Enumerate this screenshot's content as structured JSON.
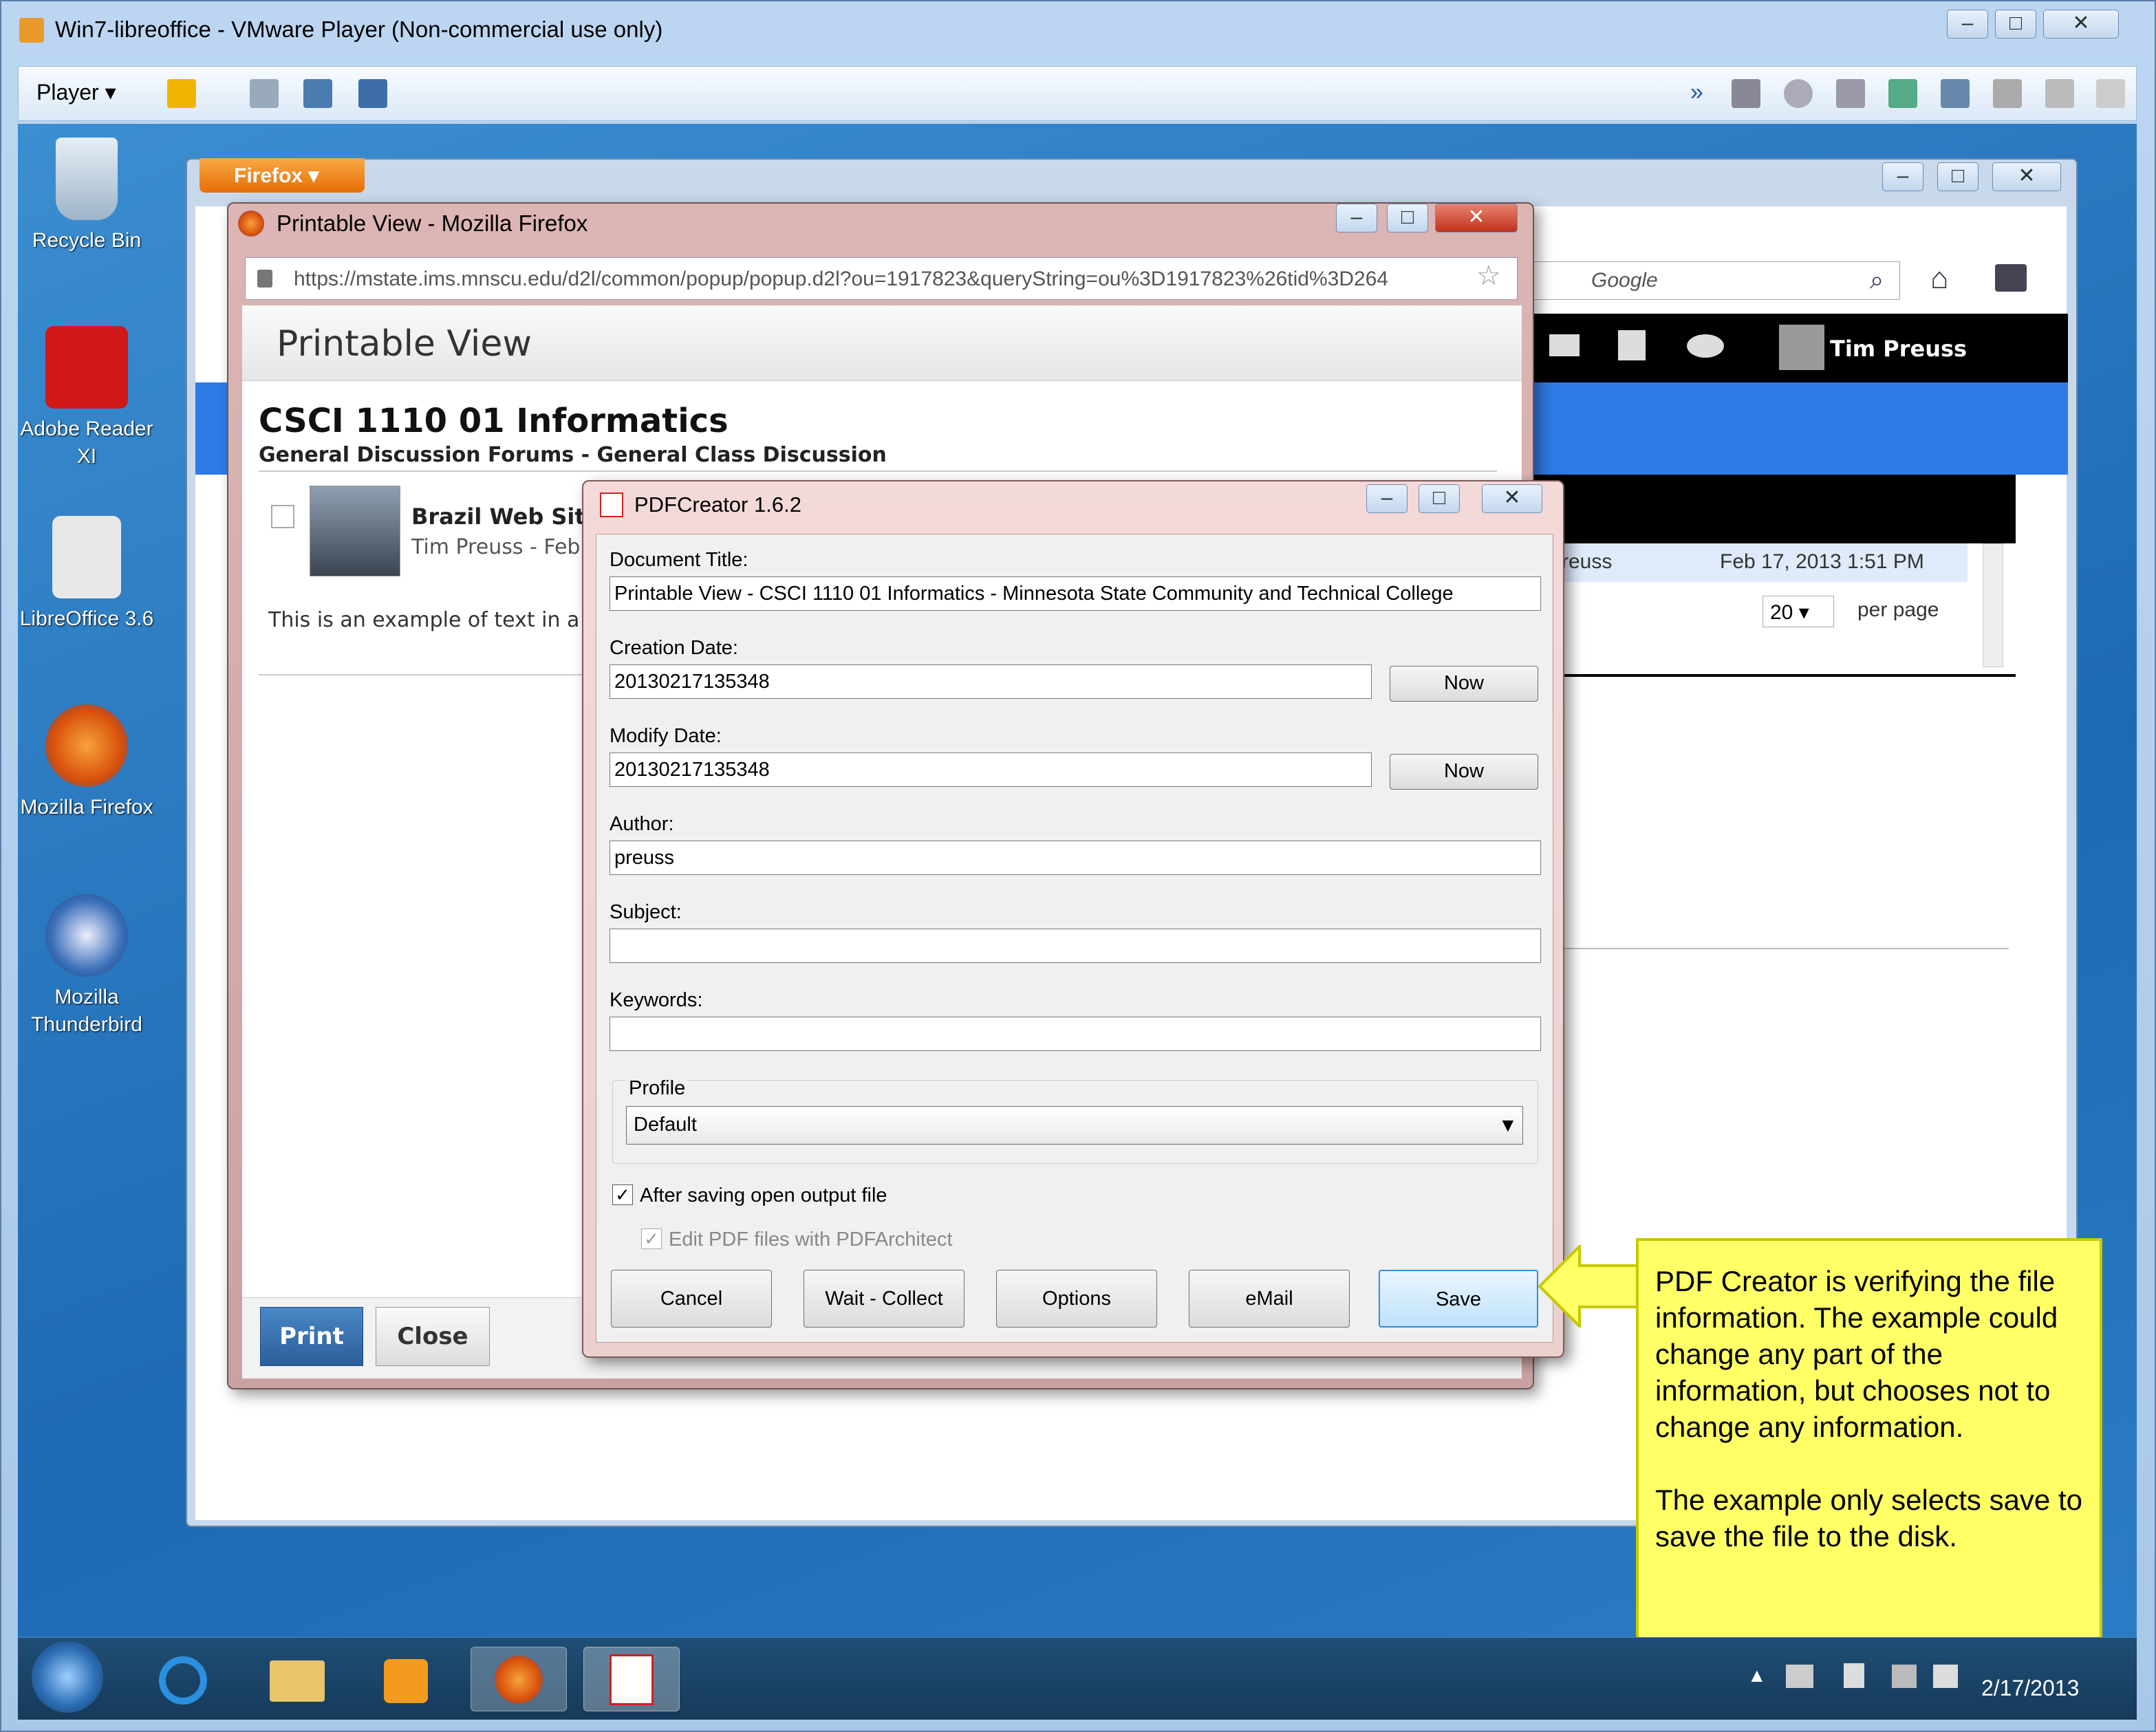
{
  "vmware": {
    "title": "Win7-libreoffice - VMware Player (Non-commercial use only)",
    "player_menu": "Player"
  },
  "desktop_icons": [
    {
      "label": "Recycle Bin"
    },
    {
      "label": "Adobe Reader XI"
    },
    {
      "label": "LibreOffice 3.6"
    },
    {
      "label": "Mozilla Firefox"
    },
    {
      "label": "Mozilla Thunderbird"
    }
  ],
  "firefox": {
    "app_button": "Firefox",
    "search_placeholder": "Google",
    "user_name": "Tim Preuss",
    "list_row_author": "reuss",
    "list_row_date": "Feb 17, 2013 1:51 PM",
    "per_page_value": "20",
    "per_page_label": "per page"
  },
  "printable_view": {
    "window_title": "Printable View - Mozilla Firefox",
    "url": "https://mstate.ims.mnscu.edu/d2l/common/popup/popup.d2l?ou=1917823&queryString=ou%3D1917823%26tid%3D264",
    "heading": "Printable View",
    "course": "CSCI 1110 01 Informatics",
    "forum": "General Discussion Forums - General Class Discussion",
    "post_title": "Brazil Web Site",
    "post_author": "Tim Preuss - Feb",
    "post_body": "This is an example of text in a",
    "print_label": "Print",
    "close_label": "Close"
  },
  "pdfcreator": {
    "title": "PDFCreator 1.6.2",
    "document_title_label": "Document Title:",
    "document_title_value": "Printable View - CSCI 1110 01 Informatics - Minnesota State Community and Technical College",
    "creation_date_label": "Creation Date:",
    "creation_date_value": "20130217135348",
    "modify_date_label": "Modify Date:",
    "modify_date_value": "20130217135348",
    "now_label": "Now",
    "author_label": "Author:",
    "author_value": "preuss",
    "subject_label": "Subject:",
    "subject_value": "",
    "keywords_label": "Keywords:",
    "keywords_value": "",
    "profile_label": "Profile",
    "profile_value": "Default",
    "after_saving_label": "After saving open output file",
    "after_saving_checked": true,
    "edit_pdf_label": "Edit PDF files with PDFArchitect",
    "edit_pdf_checked": true,
    "buttons": {
      "cancel": "Cancel",
      "wait_collect": "Wait - Collect",
      "options": "Options",
      "email": "eMail",
      "save": "Save"
    }
  },
  "callout": {
    "paragraph1": "PDF Creator is verifying the file information. The example could change any part of the information, but chooses not to change any information.",
    "paragraph2": "The example only selects save to save the file to the disk."
  },
  "taskbar": {
    "date": "2/17/2013"
  },
  "colors": {
    "accent_blue": "#2f7be6",
    "callout_yellow": "#ffff66",
    "print_button": "#2b5f9a"
  }
}
